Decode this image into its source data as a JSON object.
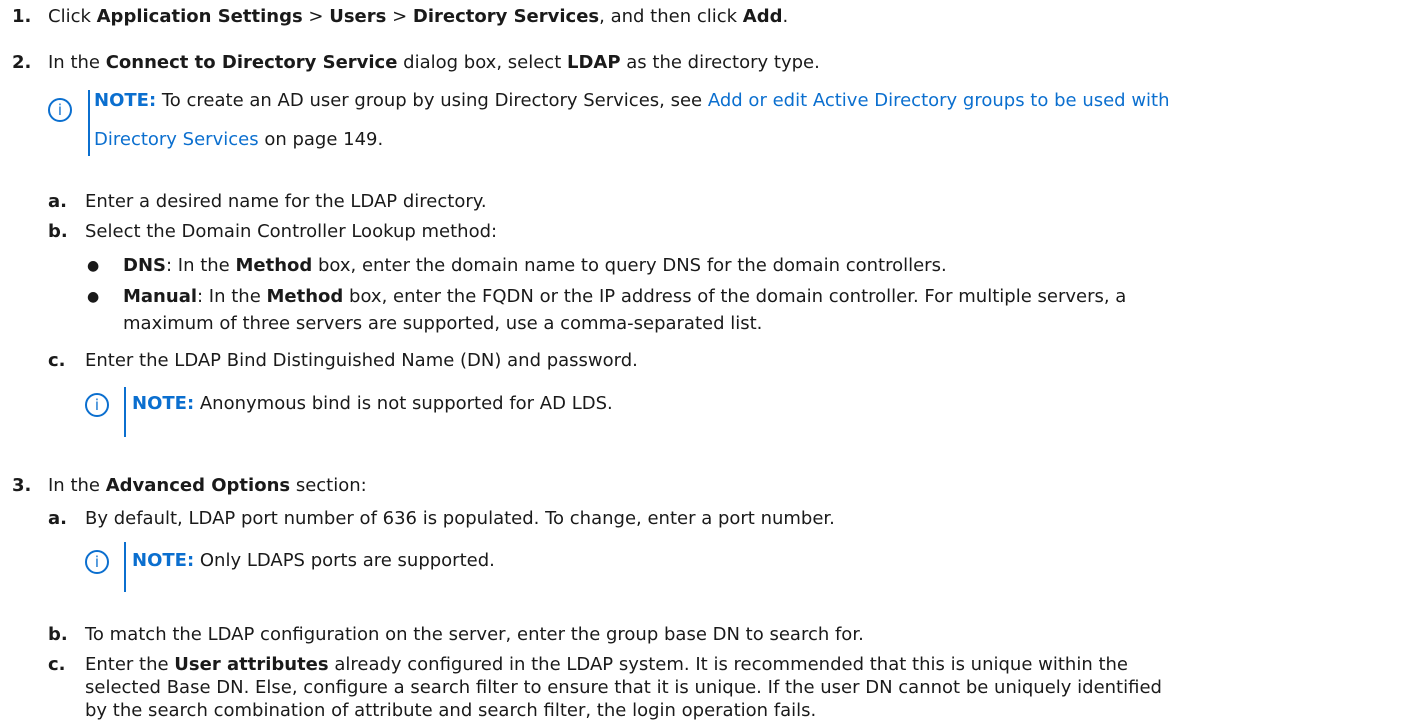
{
  "step1": {
    "num": "1.",
    "t1": "Click ",
    "b1": "Application Settings",
    "t2": " > ",
    "b2": "Users",
    "t3": " > ",
    "b3": "Directory Services",
    "t4": ", and then click ",
    "b4": "Add",
    "t5": "."
  },
  "step2": {
    "num": "2.",
    "t1": "In the ",
    "b1": "Connect to Directory Service",
    "t2": " dialog box, select ",
    "b2": "LDAP",
    "t3": " as the directory type."
  },
  "note1": {
    "icon": "i",
    "label": "NOTE:",
    "t1": " To create an AD user group by using Directory Services, see ",
    "link_line1": "Add or edit Active Directory groups to be used with",
    "link_line2": "Directory Services",
    "t2": " on page 149."
  },
  "sub_a": {
    "letter": "a.",
    "text": "Enter a desired name for the LDAP directory."
  },
  "sub_b": {
    "letter": "b.",
    "text": "Select the Domain Controller Lookup method:",
    "bullets": [
      {
        "b1": "DNS",
        "t1": ": In the ",
        "b2": "Method",
        "t2": " box, enter the domain name to query DNS for the domain controllers."
      },
      {
        "b1": "Manual",
        "t1": ": In the ",
        "b2": "Method",
        "t2": " box, enter the FQDN or the IP address of the domain controller. For multiple servers, a",
        "line2": "maximum of three servers are supported, use a comma-separated list."
      }
    ]
  },
  "sub_c": {
    "letter": "c.",
    "text": "Enter the LDAP Bind Distinguished Name (DN) and password."
  },
  "note2": {
    "icon": "i",
    "label": "NOTE:",
    "text": " Anonymous bind is not supported for AD LDS."
  },
  "step3": {
    "num": "3.",
    "t1": "In the ",
    "b1": "Advanced Options",
    "t2": " section:"
  },
  "sub3_a": {
    "letter": "a.",
    "text": "By default, LDAP port number of 636 is populated. To change, enter a port number."
  },
  "note3": {
    "icon": "i",
    "label": "NOTE:",
    "text": " Only LDAPS ports are supported."
  },
  "sub3_b": {
    "letter": "b.",
    "text": "To match the LDAP configuration on the server, enter the group base DN to search for."
  },
  "sub3_c": {
    "letter": "c.",
    "t1": "Enter the ",
    "b1": "User attributes",
    "t2": " already configured in the LDAP system. It is recommended that this is unique within the",
    "line2": "selected Base DN. Else, configure a search filter to ensure that it is unique. If the user DN cannot be uniquely identified",
    "line3": "by the search combination of attribute and search filter, the login operation fails."
  }
}
